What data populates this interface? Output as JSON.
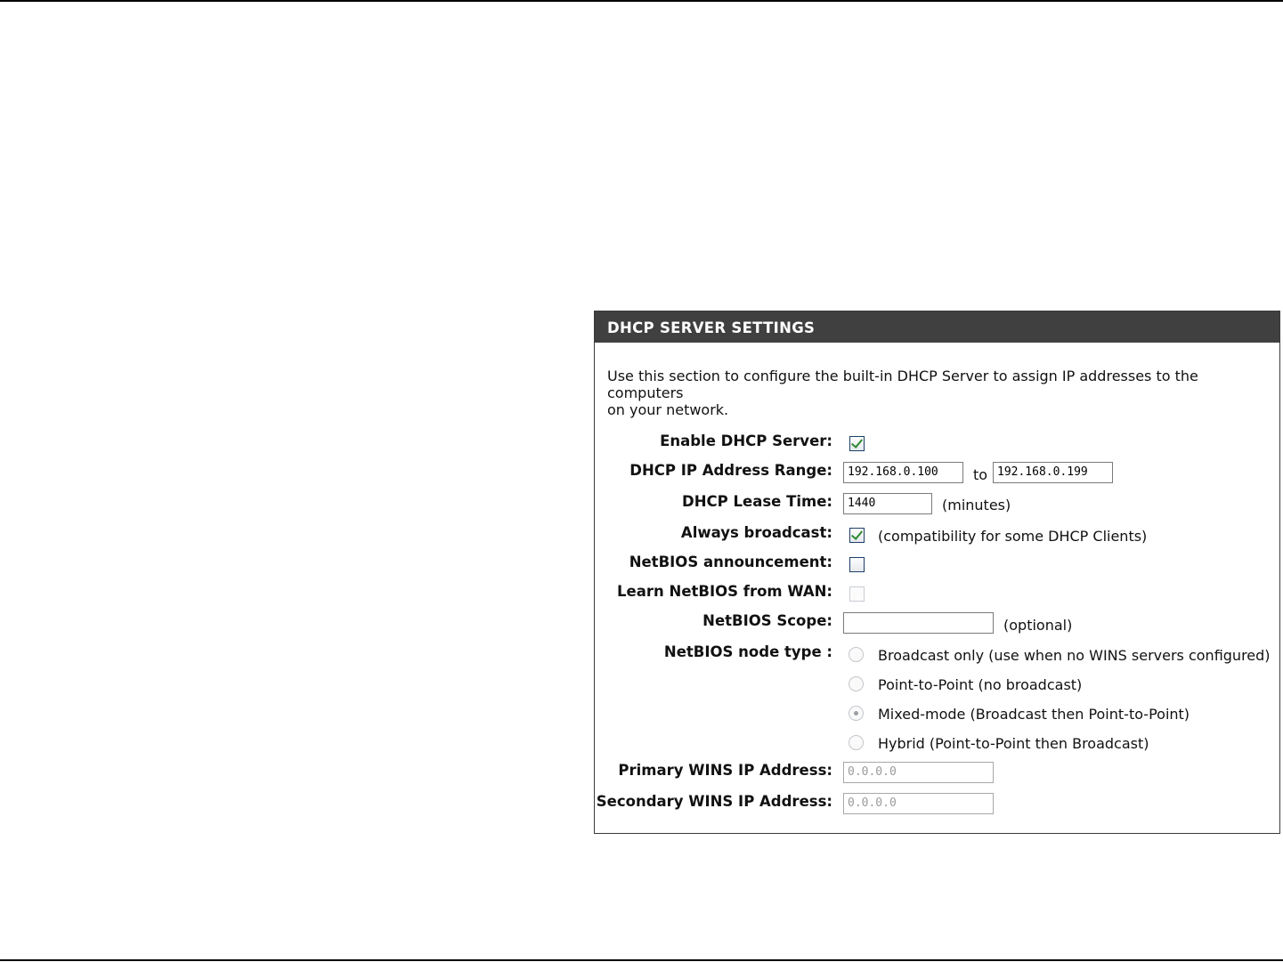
{
  "section": {
    "title": "DHCP SERVER SETTINGS",
    "description_line1": "Use this section to configure the built-in DHCP Server to assign IP addresses to the computers",
    "description_line2": "on your network."
  },
  "fields": {
    "enable_dhcp": {
      "label": "Enable DHCP Server:",
      "checked": true
    },
    "ip_range": {
      "label": "DHCP IP Address Range:",
      "start": "192.168.0.100",
      "to_label": "to",
      "end": "192.168.0.199"
    },
    "lease_time": {
      "label": "DHCP Lease Time:",
      "value": "1440",
      "unit": "(minutes)"
    },
    "always_broadcast": {
      "label": "Always broadcast:",
      "checked": true,
      "note": "(compatibility for some DHCP Clients)"
    },
    "netbios_announcement": {
      "label": "NetBIOS announcement:",
      "checked": false
    },
    "learn_netbios": {
      "label": "Learn NetBIOS from WAN:",
      "checked": false,
      "disabled": true
    },
    "netbios_scope": {
      "label": "NetBIOS Scope:",
      "value": "",
      "note": "(optional)"
    },
    "node_type": {
      "label": "NetBIOS node type :",
      "options": [
        {
          "label": "Broadcast only (use when no WINS servers configured)",
          "selected": false
        },
        {
          "label": "Point-to-Point (no broadcast)",
          "selected": false
        },
        {
          "label": "Mixed-mode (Broadcast then Point-to-Point)",
          "selected": true
        },
        {
          "label": "Hybrid (Point-to-Point then Broadcast)",
          "selected": false
        }
      ]
    },
    "primary_wins": {
      "label": "Primary WINS IP Address:",
      "value": "0.0.0.0"
    },
    "secondary_wins": {
      "label": "Secondary WINS IP Address:",
      "value": "0.0.0.0"
    }
  },
  "colors": {
    "header_bg": "#404040",
    "header_text": "#ffffff",
    "check_color": "#2d8a2d"
  }
}
